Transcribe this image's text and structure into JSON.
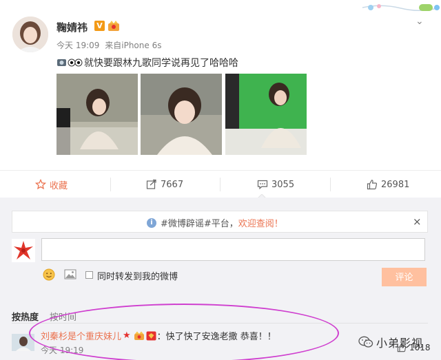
{
  "post": {
    "username": "鞠婧祎",
    "verified_badge": "V",
    "time": "今天 19:09",
    "source_prefix": "来自",
    "source": "iPhone 6s",
    "text": "就快要跟林九歌同学说再见了哈哈哈",
    "icons": [
      "chevron-down-icon",
      "crown-badge-icon",
      "camera-emoji-icon"
    ]
  },
  "actions": {
    "favorite": "收藏",
    "repost": "7667",
    "comment": "3055",
    "like": "26981"
  },
  "notice": {
    "prefix": "#微博辟谣#平台，",
    "link": "欢迎查阅！",
    "close": "×"
  },
  "composer": {
    "input_value": "",
    "repost_label": "同时转发到我的微博",
    "submit_label": "评论"
  },
  "sort": {
    "active": "按热度",
    "other": "按时间"
  },
  "comment": {
    "user": "刘秦杉是个重庆妹儿",
    "star": "★",
    "text": "：快了快了安逸老撒 恭喜！！",
    "time": "今天 19:19",
    "likes": "1018"
  },
  "watermark": {
    "text": "小弟影视"
  },
  "colors": {
    "accent": "#eb7350",
    "submit_bg": "#ffc09f",
    "annotation_oval": "#cf3fcf",
    "comment_bg": "#f2f2f5"
  }
}
